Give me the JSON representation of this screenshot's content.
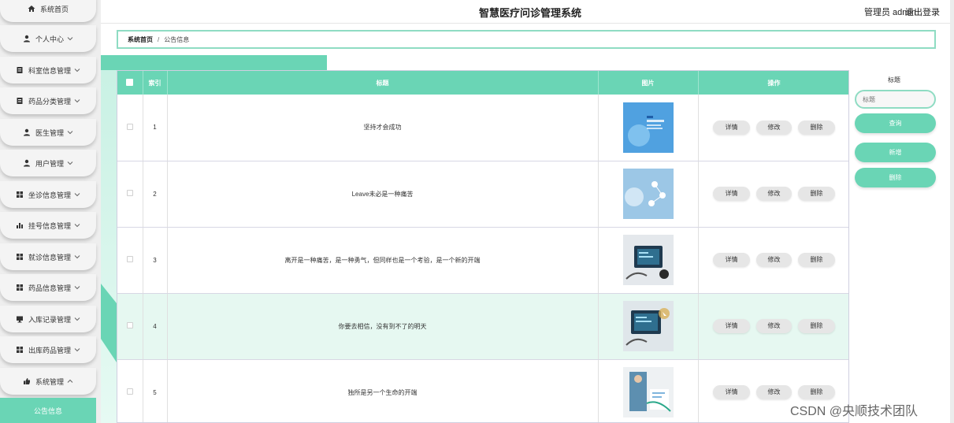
{
  "header": {
    "title": "智慧医疗问诊管理系统",
    "user": "管理员 admin",
    "logout": "退出登录"
  },
  "sidebar": {
    "items": [
      {
        "label": "系统首页",
        "icon": "home-icon"
      },
      {
        "label": "个人中心",
        "icon": "person-icon"
      },
      {
        "label": "科室信息管理",
        "icon": "doc-icon"
      },
      {
        "label": "药品分类管理",
        "icon": "doc-icon"
      },
      {
        "label": "医生管理",
        "icon": "person-icon"
      },
      {
        "label": "用户管理",
        "icon": "person-icon"
      },
      {
        "label": "坐诊信息管理",
        "icon": "grid-icon"
      },
      {
        "label": "挂号信息管理",
        "icon": "bar-chart-icon"
      },
      {
        "label": "就诊信息管理",
        "icon": "grid-icon"
      },
      {
        "label": "药品信息管理",
        "icon": "grid-icon"
      },
      {
        "label": "入库记录管理",
        "icon": "monitor-icon"
      },
      {
        "label": "出库药品管理",
        "icon": "grid-icon"
      },
      {
        "label": "系统管理",
        "icon": "thumb-icon"
      }
    ],
    "active_sub": "公告信息"
  },
  "breadcrumb": {
    "home": "系统首页",
    "sep": "/",
    "current": "公告信息"
  },
  "table": {
    "headers": {
      "index": "索引",
      "title": "标题",
      "image": "图片",
      "actions": "操作"
    },
    "rows": [
      {
        "index": "1",
        "title": "坚持才会成功"
      },
      {
        "index": "2",
        "title": "Leave未必是一种痛苦"
      },
      {
        "index": "3",
        "title": "离开是一种痛苦，是一种勇气，但同样也是一个考验，是一个新的开端"
      },
      {
        "index": "4",
        "title": "你要去相信，没有到不了的明天"
      },
      {
        "index": "5",
        "title": "独所是另一个生命的开端"
      }
    ],
    "actions": {
      "detail": "详情",
      "edit": "修改",
      "delete": "删除"
    }
  },
  "search": {
    "label": "标题",
    "placeholder": "标题",
    "search_btn": "查询",
    "add_btn": "新增",
    "delete_btn": "删除"
  },
  "watermark": "CSDN @央顺技术团队",
  "colors": {
    "accent": "#6ad5b5",
    "highlight_row": "#e6f8f1"
  }
}
